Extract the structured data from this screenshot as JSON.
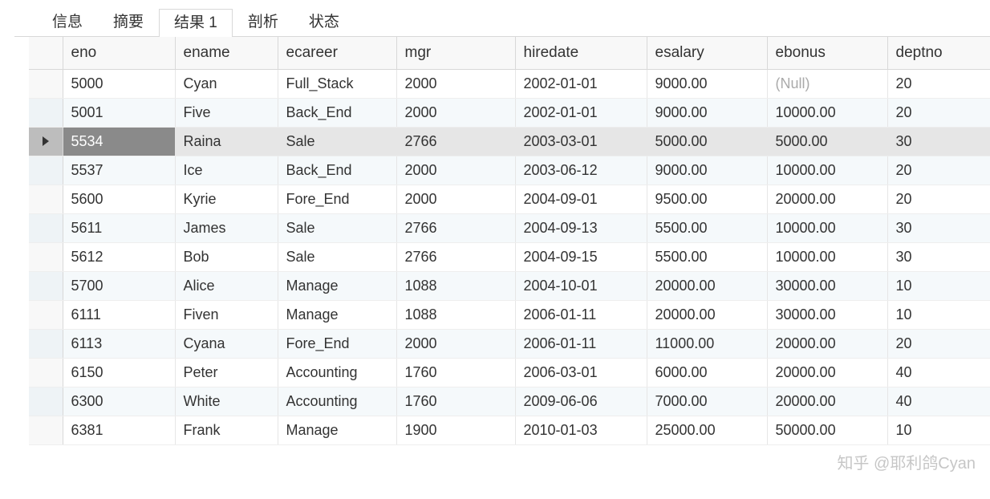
{
  "tabs": [
    {
      "label": "信息",
      "active": false
    },
    {
      "label": "摘要",
      "active": false
    },
    {
      "label": "结果 1",
      "active": true
    },
    {
      "label": "剖析",
      "active": false
    },
    {
      "label": "状态",
      "active": false
    }
  ],
  "columns": [
    {
      "key": "eno",
      "label": "eno",
      "align": "right"
    },
    {
      "key": "ename",
      "label": "ename",
      "align": "left"
    },
    {
      "key": "ecareer",
      "label": "ecareer",
      "align": "left"
    },
    {
      "key": "mgr",
      "label": "mgr",
      "align": "right"
    },
    {
      "key": "hiredate",
      "label": "hiredate",
      "align": "left"
    },
    {
      "key": "esalary",
      "label": "esalary",
      "align": "right"
    },
    {
      "key": "ebonus",
      "label": "ebonus",
      "align": "right"
    },
    {
      "key": "deptno",
      "label": "deptno",
      "align": "right"
    }
  ],
  "null_display": "(Null)",
  "selected_row_index": 2,
  "rows": [
    {
      "eno": "5000",
      "ename": "Cyan",
      "ecareer": "Full_Stack",
      "mgr": "2000",
      "hiredate": "2002-01-01",
      "esalary": "9000.00",
      "ebonus": null,
      "deptno": "20"
    },
    {
      "eno": "5001",
      "ename": "Five",
      "ecareer": "Back_End",
      "mgr": "2000",
      "hiredate": "2002-01-01",
      "esalary": "9000.00",
      "ebonus": "10000.00",
      "deptno": "20"
    },
    {
      "eno": "5534",
      "ename": "Raina",
      "ecareer": "Sale",
      "mgr": "2766",
      "hiredate": "2003-03-01",
      "esalary": "5000.00",
      "ebonus": "5000.00",
      "deptno": "30"
    },
    {
      "eno": "5537",
      "ename": "Ice",
      "ecareer": "Back_End",
      "mgr": "2000",
      "hiredate": "2003-06-12",
      "esalary": "9000.00",
      "ebonus": "10000.00",
      "deptno": "20"
    },
    {
      "eno": "5600",
      "ename": "Kyrie",
      "ecareer": "Fore_End",
      "mgr": "2000",
      "hiredate": "2004-09-01",
      "esalary": "9500.00",
      "ebonus": "20000.00",
      "deptno": "20"
    },
    {
      "eno": "5611",
      "ename": "James",
      "ecareer": "Sale",
      "mgr": "2766",
      "hiredate": "2004-09-13",
      "esalary": "5500.00",
      "ebonus": "10000.00",
      "deptno": "30"
    },
    {
      "eno": "5612",
      "ename": "Bob",
      "ecareer": "Sale",
      "mgr": "2766",
      "hiredate": "2004-09-15",
      "esalary": "5500.00",
      "ebonus": "10000.00",
      "deptno": "30"
    },
    {
      "eno": "5700",
      "ename": "Alice",
      "ecareer": "Manage",
      "mgr": "1088",
      "hiredate": "2004-10-01",
      "esalary": "20000.00",
      "ebonus": "30000.00",
      "deptno": "10"
    },
    {
      "eno": "6111",
      "ename": "Fiven",
      "ecareer": "Manage",
      "mgr": "1088",
      "hiredate": "2006-01-11",
      "esalary": "20000.00",
      "ebonus": "30000.00",
      "deptno": "10"
    },
    {
      "eno": "6113",
      "ename": "Cyana",
      "ecareer": "Fore_End",
      "mgr": "2000",
      "hiredate": "2006-01-11",
      "esalary": "11000.00",
      "ebonus": "20000.00",
      "deptno": "20"
    },
    {
      "eno": "6150",
      "ename": "Peter",
      "ecareer": "Accounting",
      "mgr": "1760",
      "hiredate": "2006-03-01",
      "esalary": "6000.00",
      "ebonus": "20000.00",
      "deptno": "40"
    },
    {
      "eno": "6300",
      "ename": "White",
      "ecareer": "Accounting",
      "mgr": "1760",
      "hiredate": "2009-06-06",
      "esalary": "7000.00",
      "ebonus": "20000.00",
      "deptno": "40"
    },
    {
      "eno": "6381",
      "ename": "Frank",
      "ecareer": "Manage",
      "mgr": "1900",
      "hiredate": "2010-01-03",
      "esalary": "25000.00",
      "ebonus": "50000.00",
      "deptno": "10"
    }
  ],
  "watermark": "知乎 @耶利鸽Cyan"
}
